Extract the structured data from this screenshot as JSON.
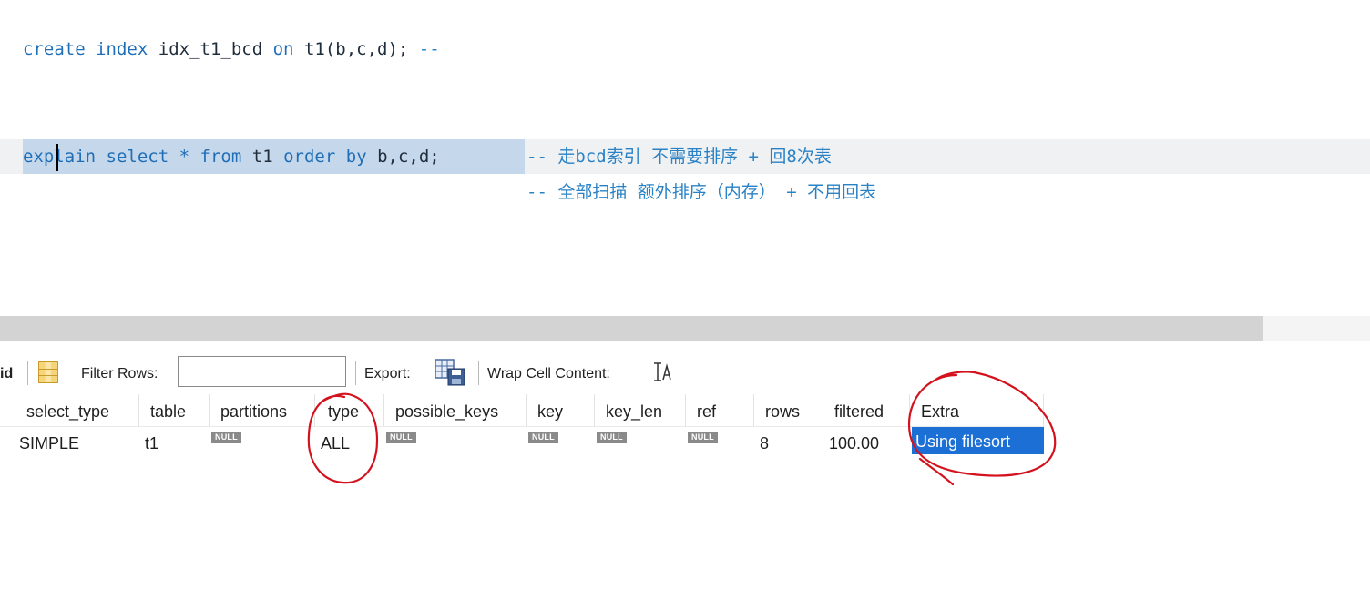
{
  "editor": {
    "line1": {
      "kw1": "create",
      "kw2": "index",
      "ident": "idx_t1_bcd",
      "kw3": "on",
      "rest": "t1(b,c,d);",
      "comment": "--"
    },
    "line2": {
      "kw1": "explain",
      "kw2": "select",
      "star": "*",
      "kw3": "from",
      "ident": "t1",
      "kw4": "order",
      "kw5": "by",
      "rest": "b,c,d;",
      "comment": "-- 走bcd索引 不需要排序 + 回8次表"
    },
    "line3": {
      "comment": "-- 全部扫描 额外排序（内存） + 不用回表"
    }
  },
  "toolbar": {
    "grid_label": "id",
    "filter_label": "Filter Rows:",
    "filter_value": "",
    "export_label": "Export:",
    "wrap_label": "Wrap Cell Content:"
  },
  "result": {
    "columns": [
      "select_type",
      "table",
      "partitions",
      "type",
      "possible_keys",
      "key",
      "key_len",
      "ref",
      "rows",
      "filtered",
      "Extra"
    ],
    "row": {
      "select_type": "SIMPLE",
      "table": "t1",
      "partitions": "NULL",
      "type": "ALL",
      "possible_keys": "NULL",
      "key": "NULL",
      "key_len": "NULL",
      "ref": "NULL",
      "rows": "8",
      "filtered": "100.00",
      "Extra": "Using filesort"
    }
  },
  "colors": {
    "keyword": "#1f6fb8",
    "comment": "#2a82c6",
    "selection": "#c5d7ea",
    "selected_cell": "#1c6fd4",
    "annotation": "#d4121e"
  }
}
